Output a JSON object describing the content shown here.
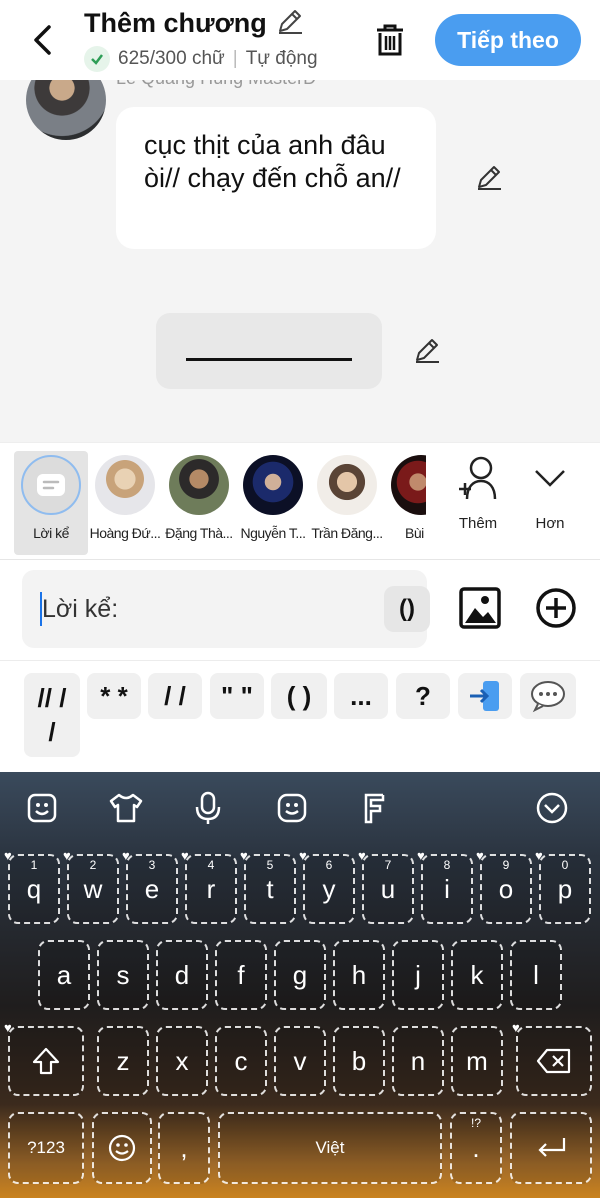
{
  "header": {
    "title": "Thêm chương",
    "word_count": "625/300 chữ",
    "mode": "Tự động",
    "next_label": "Tiếp theo"
  },
  "chat": {
    "author_name": "Lê Quang Hùng MasterD",
    "message": "cục thịt của anh đâu òi// chạy đến chỗ an//"
  },
  "characters": [
    {
      "label": "Lời kể"
    },
    {
      "label": "Hoàng Đứ..."
    },
    {
      "label": "Đặng Thà..."
    },
    {
      "label": "Nguyễn T..."
    },
    {
      "label": "Trần Đăng..."
    },
    {
      "label": "Bùi Ti"
    }
  ],
  "strip_actions": {
    "add_label": "Thêm",
    "more_label": "Hơn"
  },
  "input": {
    "label": "Lời kể:",
    "paren_button": "()"
  },
  "chips": [
    "// /\n/",
    "* *",
    "/ /",
    "\" \"",
    "( )",
    "...",
    "?"
  ],
  "keyboard": {
    "row1": [
      [
        "q",
        "1"
      ],
      [
        "w",
        "2"
      ],
      [
        "e",
        "3"
      ],
      [
        "r",
        "4"
      ],
      [
        "t",
        "5"
      ],
      [
        "y",
        "6"
      ],
      [
        "u",
        "7"
      ],
      [
        "i",
        "8"
      ],
      [
        "o",
        "9"
      ],
      [
        "p",
        "0"
      ]
    ],
    "row2": [
      "a",
      "s",
      "d",
      "f",
      "g",
      "h",
      "j",
      "k",
      "l"
    ],
    "row3": [
      "z",
      "x",
      "c",
      "v",
      "b",
      "n",
      "m"
    ],
    "symbols_label": "?123",
    "comma_label": ",",
    "space_label": "Việt",
    "period_label": ".",
    "period_hint": "!?"
  }
}
